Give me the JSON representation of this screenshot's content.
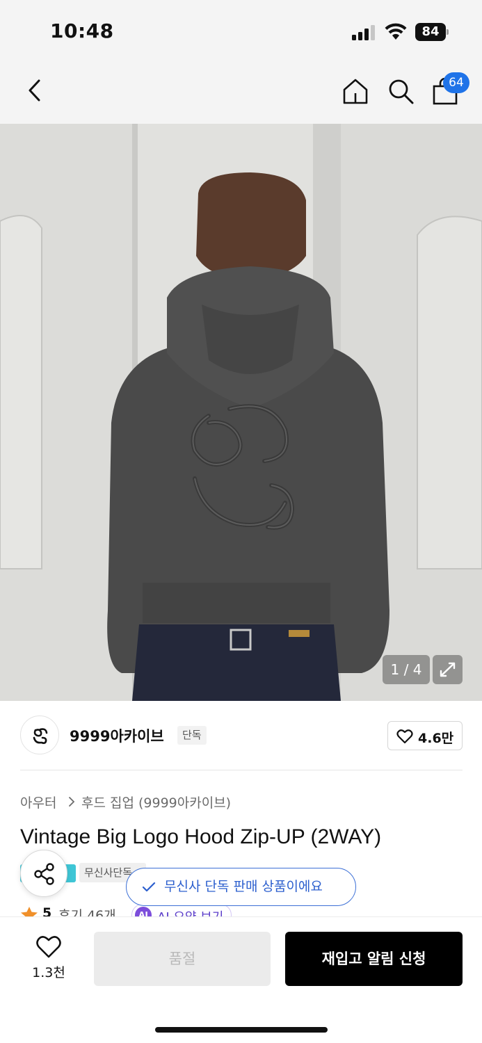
{
  "status_bar": {
    "time": "10:48",
    "battery": "84"
  },
  "nav": {
    "back_icon": "chevron-left-icon",
    "home_icon": "home-icon",
    "search_icon": "search-icon",
    "cart_icon": "shopping-bag-icon",
    "cart_badge": "64",
    "accent_color": "#1f73e8"
  },
  "gallery": {
    "counter": "1 / 4",
    "current_index": 1,
    "total": 4,
    "expand_icon": "expand-arrows-icon"
  },
  "brand": {
    "name": "9999아카이브",
    "tag": "단독",
    "likes": "4.6만",
    "like_icon": "heart-outline-icon"
  },
  "category": {
    "root": "아우터",
    "sub": "후드 집업 (9999아카이브)"
  },
  "product": {
    "title": "Vintage Big Logo Hood Zip-UP (2WAY)",
    "tag_partial": "무신사단독",
    "exclusive_tooltip": "무신사 단독 판매 상품이에요",
    "rating": "5",
    "reviews": "후기 46개",
    "ai_summary": "AI 요약 보기",
    "ai_badge": "AI"
  },
  "bottom_bar": {
    "wish_count": "1.3천",
    "soldout_label": "품절",
    "restock_label": "재입고 알림 신청"
  }
}
